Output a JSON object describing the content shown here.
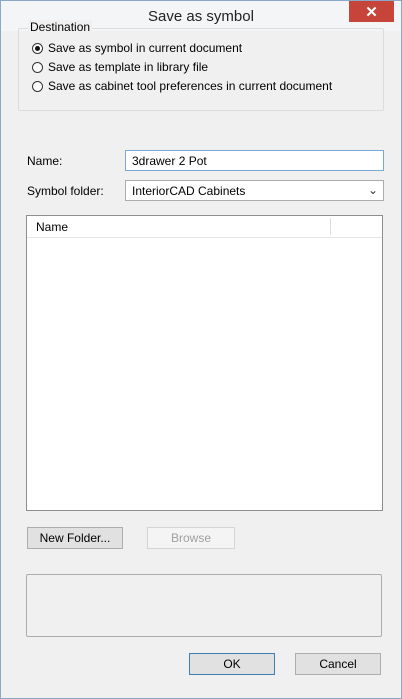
{
  "title": "Save as symbol",
  "close_glyph": "✕",
  "destination": {
    "legend": "Destination",
    "options": [
      {
        "label": "Save as symbol in current document",
        "checked": true
      },
      {
        "label": "Save as template in library file",
        "checked": false
      },
      {
        "label": "Save as cabinet tool preferences in current document",
        "checked": false
      }
    ]
  },
  "name_label": "Name:",
  "name_value": "3drawer 2 Pot",
  "folder_label": "Symbol folder:",
  "folder_value": "InteriorCAD Cabinets",
  "list": {
    "column_name": "Name"
  },
  "buttons": {
    "new_folder": "New Folder...",
    "browse": "Browse",
    "ok": "OK",
    "cancel": "Cancel"
  },
  "colors": {
    "close_bg": "#c7443b",
    "window_bg": "#f0f0f0"
  }
}
